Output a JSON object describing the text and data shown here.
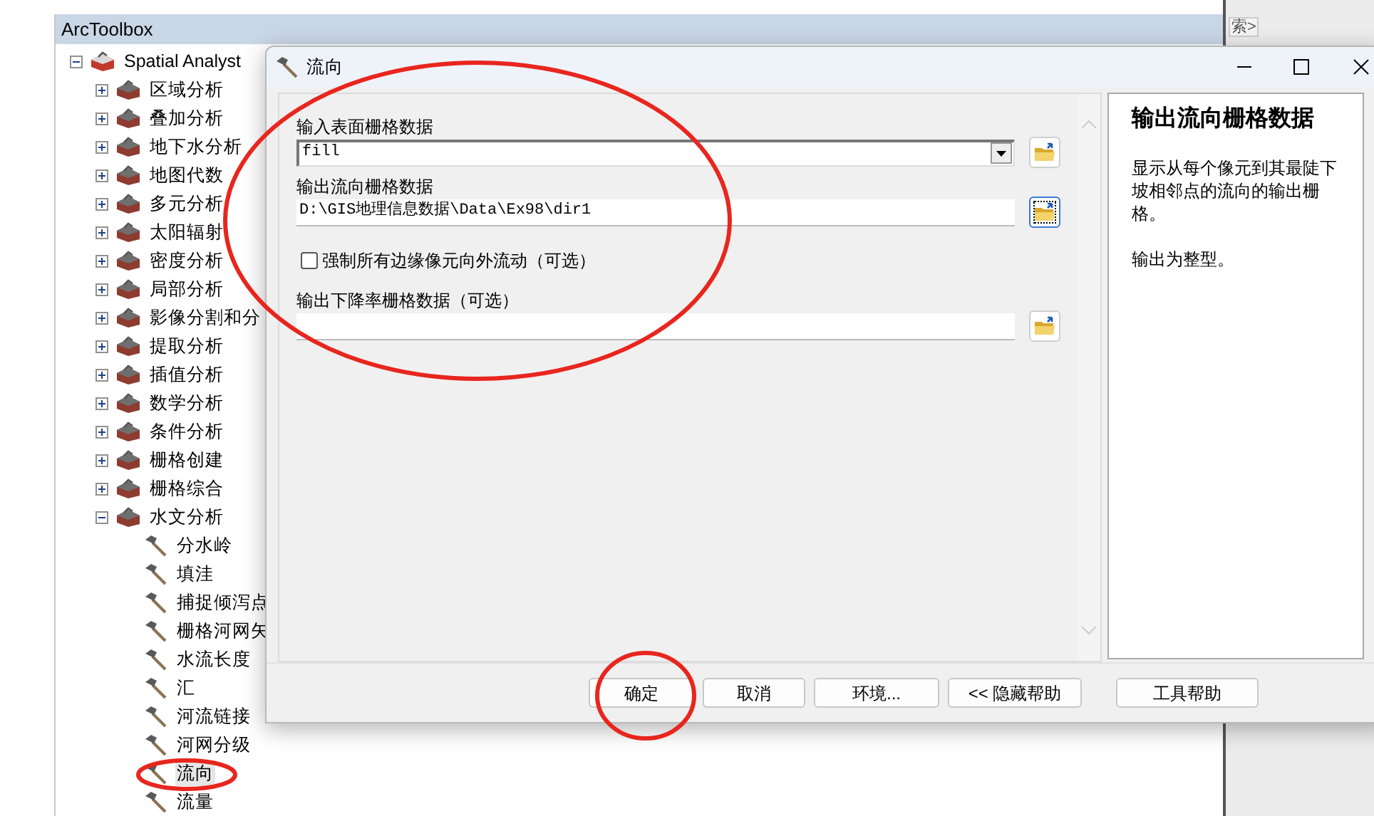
{
  "toolbox": {
    "title": "ArcToolbox",
    "tree": [
      {
        "label": "Spatial Analyst",
        "kind": "toolbox",
        "expanded": true,
        "children": [
          {
            "label": "区域分析",
            "kind": "toolset",
            "expanded": false
          },
          {
            "label": "叠加分析",
            "kind": "toolset",
            "expanded": false
          },
          {
            "label": "地下水分析",
            "kind": "toolset",
            "expanded": false
          },
          {
            "label": "地图代数",
            "kind": "toolset",
            "expanded": false
          },
          {
            "label": "多元分析",
            "kind": "toolset",
            "expanded": false
          },
          {
            "label": "太阳辐射",
            "kind": "toolset",
            "expanded": false
          },
          {
            "label": "密度分析",
            "kind": "toolset",
            "expanded": false
          },
          {
            "label": "局部分析",
            "kind": "toolset",
            "expanded": false
          },
          {
            "label": "影像分割和分",
            "kind": "toolset",
            "expanded": false
          },
          {
            "label": "提取分析",
            "kind": "toolset",
            "expanded": false
          },
          {
            "label": "插值分析",
            "kind": "toolset",
            "expanded": false
          },
          {
            "label": "数学分析",
            "kind": "toolset",
            "expanded": false
          },
          {
            "label": "条件分析",
            "kind": "toolset",
            "expanded": false
          },
          {
            "label": "栅格创建",
            "kind": "toolset",
            "expanded": false
          },
          {
            "label": "栅格综合",
            "kind": "toolset",
            "expanded": false
          },
          {
            "label": "水文分析",
            "kind": "toolset",
            "expanded": true,
            "children": [
              {
                "label": "分水岭",
                "kind": "tool",
                "selected": false
              },
              {
                "label": "填洼",
                "kind": "tool",
                "selected": false
              },
              {
                "label": "捕捉倾泻点",
                "kind": "tool",
                "selected": false
              },
              {
                "label": "栅格河网矢",
                "kind": "tool",
                "selected": false
              },
              {
                "label": "水流长度",
                "kind": "tool",
                "selected": false
              },
              {
                "label": "汇",
                "kind": "tool",
                "selected": false
              },
              {
                "label": "河流链接",
                "kind": "tool",
                "selected": false
              },
              {
                "label": "河网分级",
                "kind": "tool",
                "selected": false
              },
              {
                "label": "流向",
                "kind": "tool",
                "selected": true
              },
              {
                "label": "流量",
                "kind": "tool",
                "selected": false
              }
            ]
          }
        ]
      }
    ]
  },
  "search_hint": "索>",
  "dialog": {
    "title": "流向",
    "fields": [
      {
        "kind": "combo",
        "label": "输入表面栅格数据",
        "value": "fill",
        "focused": false
      },
      {
        "kind": "text",
        "label": "输出流向栅格数据",
        "value": "D:\\GIS地理信息数据\\Data\\Ex98\\dir1",
        "focused": true
      },
      {
        "kind": "checkbox",
        "label": "强制所有边缘像元向外流动（可选）",
        "checked": false
      },
      {
        "kind": "text",
        "label": "输出下降率栅格数据（可选）",
        "focused": false
      }
    ],
    "help": {
      "title": "输出流向栅格数据",
      "paragraphs": [
        "显示从每个像元到其最陡下坡相邻点的流向的输出栅格。",
        "输出为整型。"
      ]
    },
    "buttons": [
      "确定",
      "取消",
      "环境...",
      "<< 隐藏帮助",
      "工具帮助"
    ]
  }
}
